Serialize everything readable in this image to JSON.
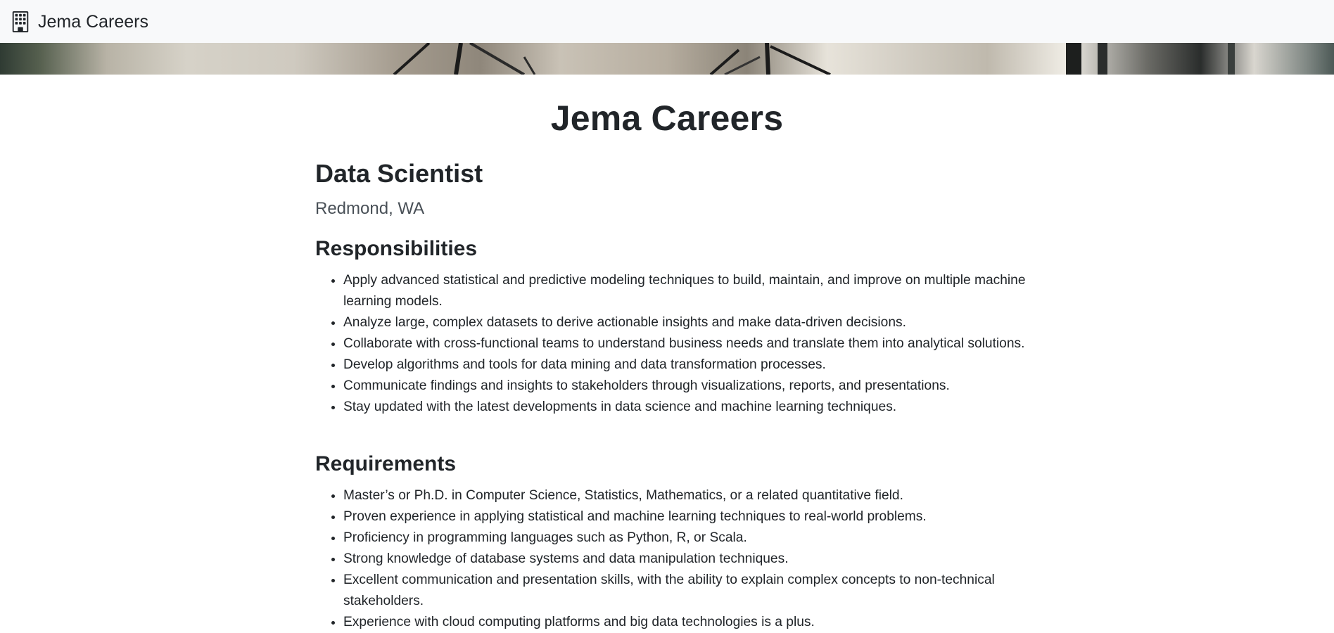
{
  "navbar": {
    "brand_text": "Jema Careers",
    "brand_icon": "building-icon"
  },
  "page": {
    "title": "Jema Careers"
  },
  "job": {
    "title": "Data Scientist",
    "location": "Redmond, WA",
    "responsibilities": {
      "heading": "Responsibilities",
      "items": [
        "Apply advanced statistical and predictive modeling techniques to build, maintain, and improve on multiple machine learning models.",
        "Analyze large, complex datasets to derive actionable insights and make data-driven decisions.",
        "Collaborate with cross-functional teams to understand business needs and translate them into analytical solutions.",
        "Develop algorithms and tools for data mining and data transformation processes.",
        "Communicate findings and insights to stakeholders through visualizations, reports, and presentations.",
        "Stay updated with the latest developments in data science and machine learning techniques."
      ]
    },
    "requirements": {
      "heading": "Requirements",
      "items": [
        "Master’s or Ph.D. in Computer Science, Statistics, Mathematics, or a related quantitative field.",
        "Proven experience in applying statistical and machine learning techniques to real-world problems.",
        "Proficiency in programming languages such as Python, R, or Scala.",
        "Strong knowledge of database systems and data manipulation techniques.",
        "Excellent communication and presentation skills, with the ability to explain complex concepts to non-technical stakeholders.",
        "Experience with cloud computing platforms and big data technologies is a plus."
      ]
    }
  },
  "colors": {
    "navbar_bg": "#f8f9fa",
    "text": "#212529",
    "muted_text": "#495057"
  }
}
